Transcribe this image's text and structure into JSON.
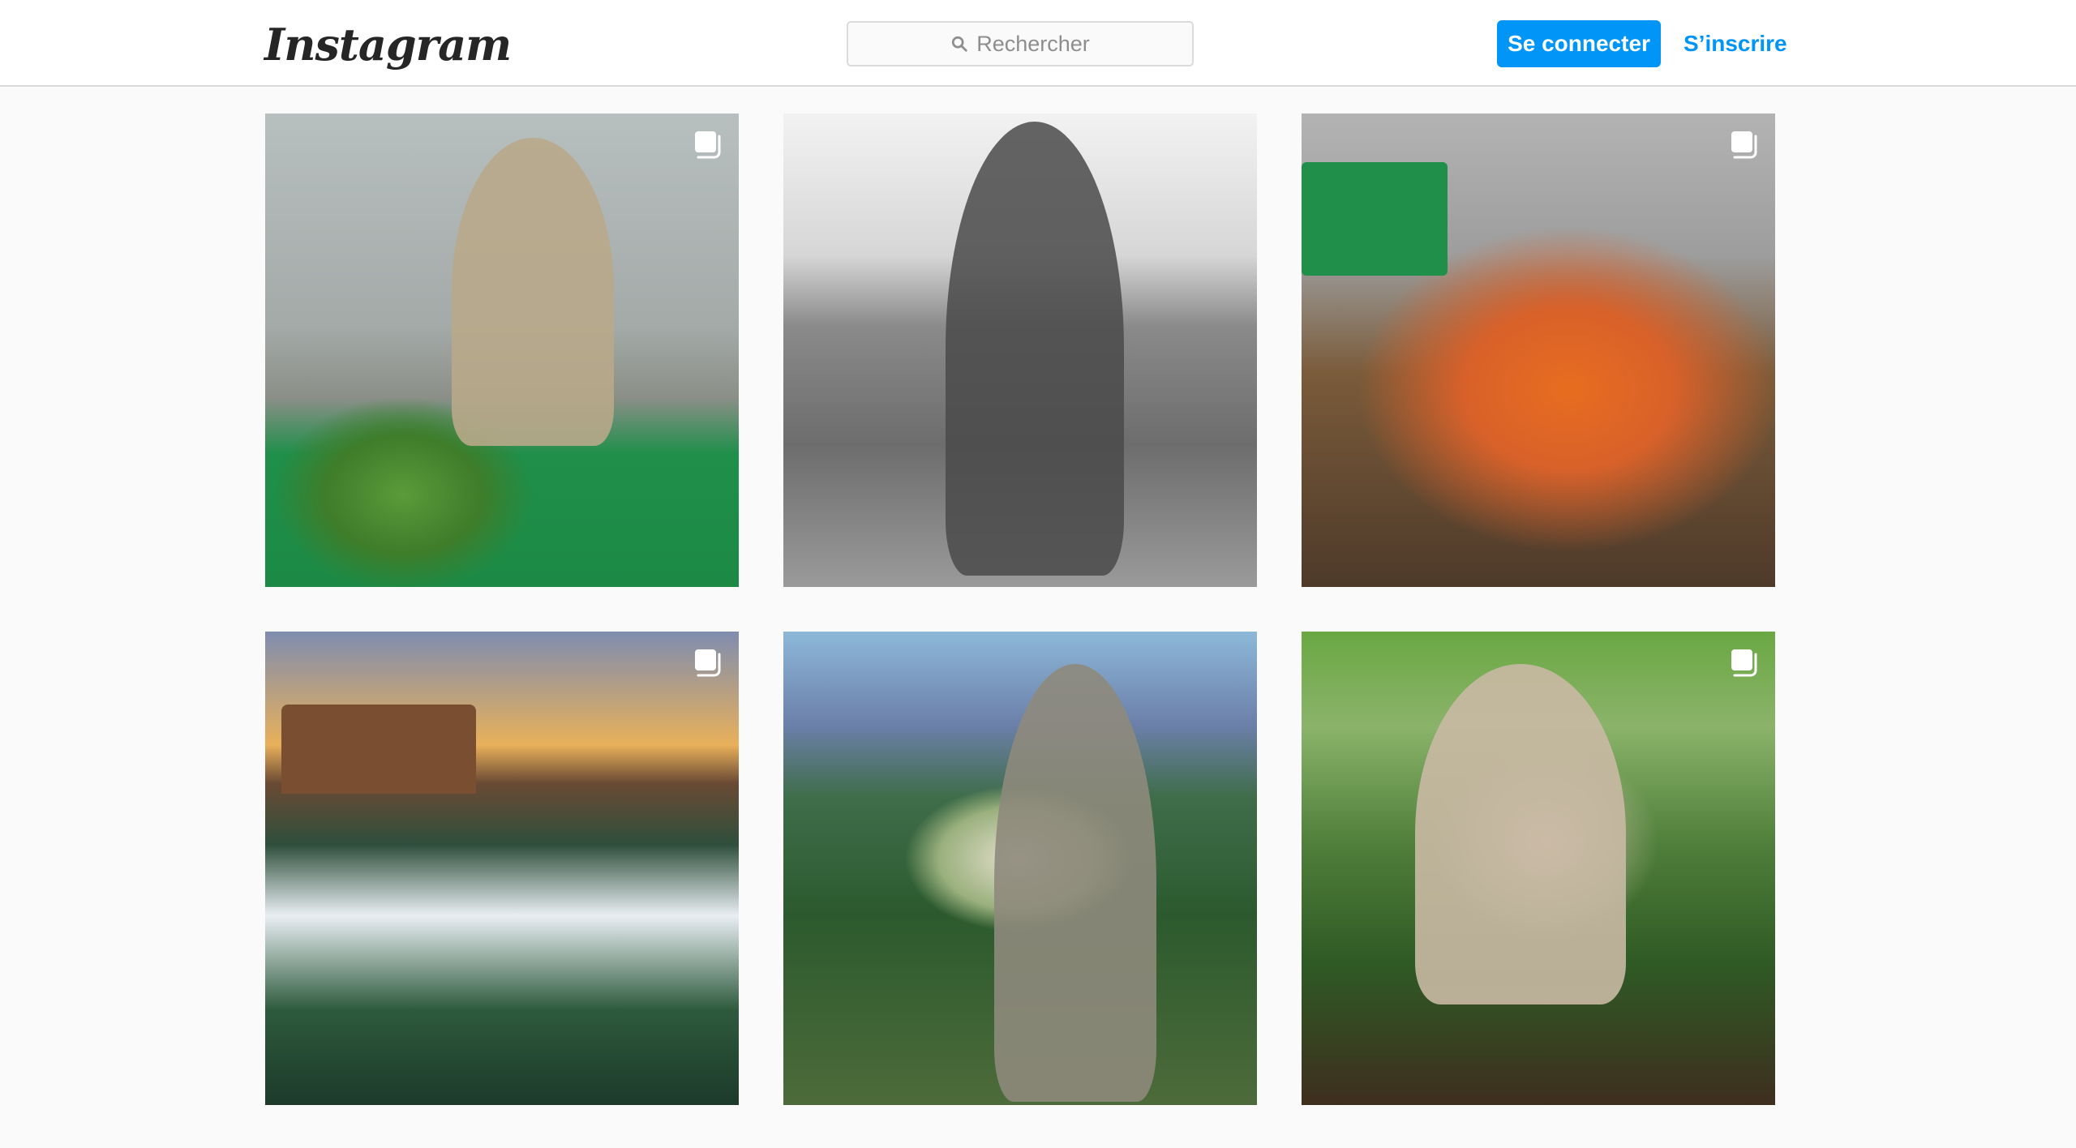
{
  "header": {
    "logo_text": "Instagram",
    "search_placeholder": "Rechercher",
    "login_label": "Se connecter",
    "signup_label": "S’inscrire"
  },
  "posts": [
    {
      "multi": true
    },
    {
      "multi": false
    },
    {
      "multi": true
    },
    {
      "multi": true
    },
    {
      "multi": false
    },
    {
      "multi": true
    }
  ],
  "colors": {
    "accent": "#0095f6",
    "border": "#dbdbdb",
    "background": "#fafafa"
  }
}
